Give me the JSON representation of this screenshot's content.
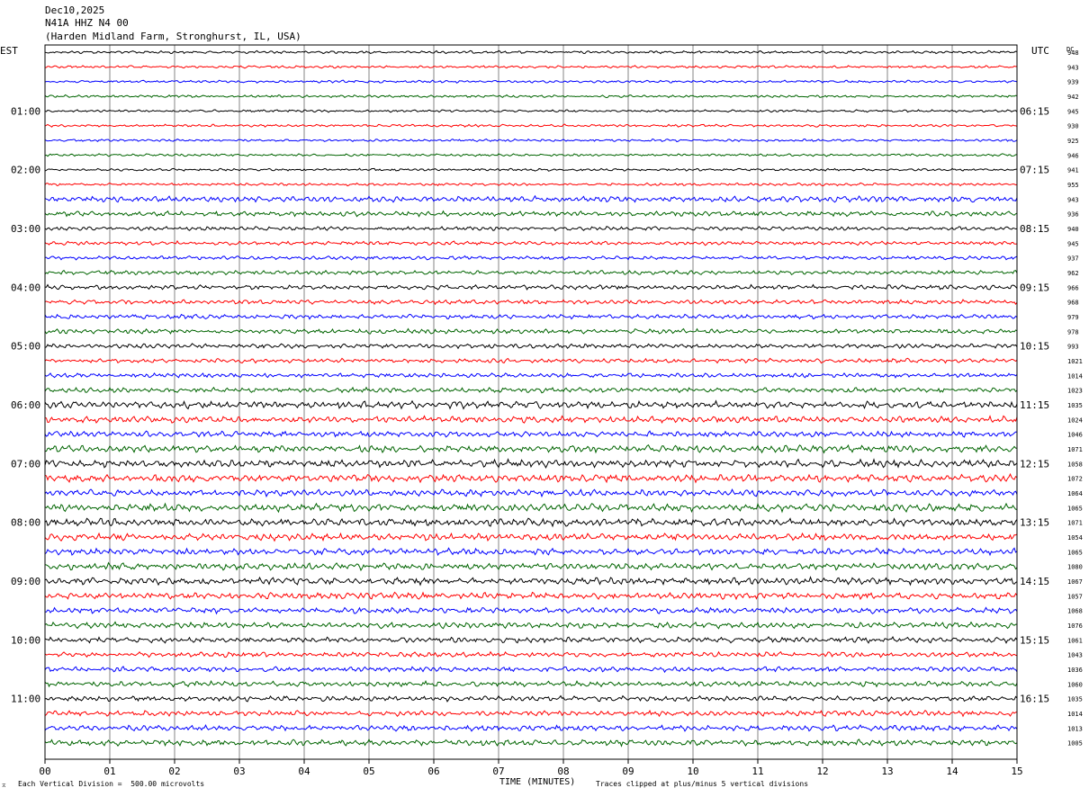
{
  "header": {
    "date": "Dec10,2025",
    "station": "N41A HHZ N4 00",
    "location": "(Harden Midland Farm, Stronghurst, IL, USA)"
  },
  "footer": {
    "scale": "Each Vertical Division =  500.00 microvolts",
    "clip": "Traces clipped at plus/minus 5 vertical divisions"
  },
  "chart_data": {
    "type": "helicorder",
    "xlabel": "TIME (MINUTES)",
    "x_ticks": [
      "00",
      "01",
      "02",
      "03",
      "04",
      "05",
      "06",
      "07",
      "08",
      "09",
      "10",
      "11",
      "12",
      "13",
      "14",
      "15"
    ],
    "xlim": [
      0,
      15
    ],
    "left_axis_label": "EST",
    "right_axis_label": "UTC",
    "dc_label": "DC",
    "left_hour_labels": [
      "01:00",
      "02:00",
      "03:00",
      "04:00",
      "05:00",
      "06:00",
      "07:00",
      "08:00",
      "09:00",
      "10:00",
      "11:00"
    ],
    "right_hour_labels": [
      "06:15",
      "07:15",
      "08:15",
      "09:15",
      "10:15",
      "11:15",
      "12:15",
      "13:15",
      "14:15",
      "15:15",
      "16:15"
    ],
    "trace_colors": [
      "#000000",
      "#ff0000",
      "#0000ff",
      "#006400"
    ],
    "dc_offsets": [
      948,
      943,
      939,
      942,
      945,
      930,
      925,
      946,
      941,
      955,
      943,
      936,
      940,
      945,
      937,
      962,
      966,
      968,
      979,
      978,
      993,
      1021,
      1014,
      1023,
      1035,
      1024,
      1046,
      1071,
      1058,
      1072,
      1064,
      1065,
      1071,
      1054,
      1065,
      1080,
      1067,
      1057,
      1068,
      1076,
      1061,
      1043,
      1036,
      1060,
      1035,
      1014,
      1013,
      1005
    ],
    "trace_amplitude": [
      1.2,
      1.1,
      1.1,
      1.1,
      1.1,
      1.1,
      1.1,
      1.1,
      1.1,
      1.2,
      2.6,
      2.2,
      1.7,
      1.7,
      1.6,
      1.8,
      2.0,
      1.9,
      1.9,
      2.0,
      2.0,
      1.9,
      1.9,
      2.2,
      3.2,
      2.8,
      2.5,
      3.1,
      3.3,
      3.3,
      2.8,
      3.3,
      3.2,
      3.0,
      2.9,
      3.0,
      3.1,
      2.8,
      2.6,
      2.6,
      2.4,
      2.2,
      2.2,
      2.3,
      2.3,
      2.3,
      2.5,
      2.6
    ]
  }
}
